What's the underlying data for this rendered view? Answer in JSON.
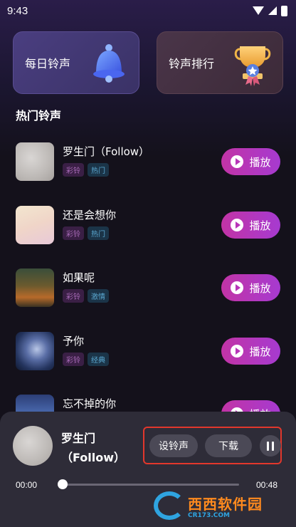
{
  "status_bar": {
    "time": "9:43"
  },
  "cards": [
    {
      "label": "每日铃声",
      "icon": "bell-icon"
    },
    {
      "label": "铃声排行",
      "icon": "trophy-icon"
    }
  ],
  "section_title": "热门铃声",
  "songs": [
    {
      "title": "罗生门（Follow）",
      "tags": [
        "彩铃",
        "热门"
      ],
      "play_label": "播放"
    },
    {
      "title": "还是会想你",
      "tags": [
        "彩铃",
        "热门"
      ],
      "play_label": "播放"
    },
    {
      "title": "如果呢",
      "tags": [
        "彩铃",
        "激情"
      ],
      "play_label": "播放"
    },
    {
      "title": "予你",
      "tags": [
        "彩铃",
        "经典"
      ],
      "play_label": "播放"
    },
    {
      "title": "忘不掉的你",
      "tags": [],
      "play_label": "播放"
    }
  ],
  "player": {
    "title": "罗生门",
    "subtitle": "（Follow）",
    "set_ringtone_label": "设铃声",
    "download_label": "下载",
    "current_time": "00:00",
    "total_time": "00:48",
    "progress": 0.0
  },
  "watermark": {
    "main": "西西软件园",
    "sub": "CR173.COM"
  },
  "colors": {
    "accent": "#c234a6",
    "highlight_box": "#e2372c",
    "background": "#14111b"
  }
}
